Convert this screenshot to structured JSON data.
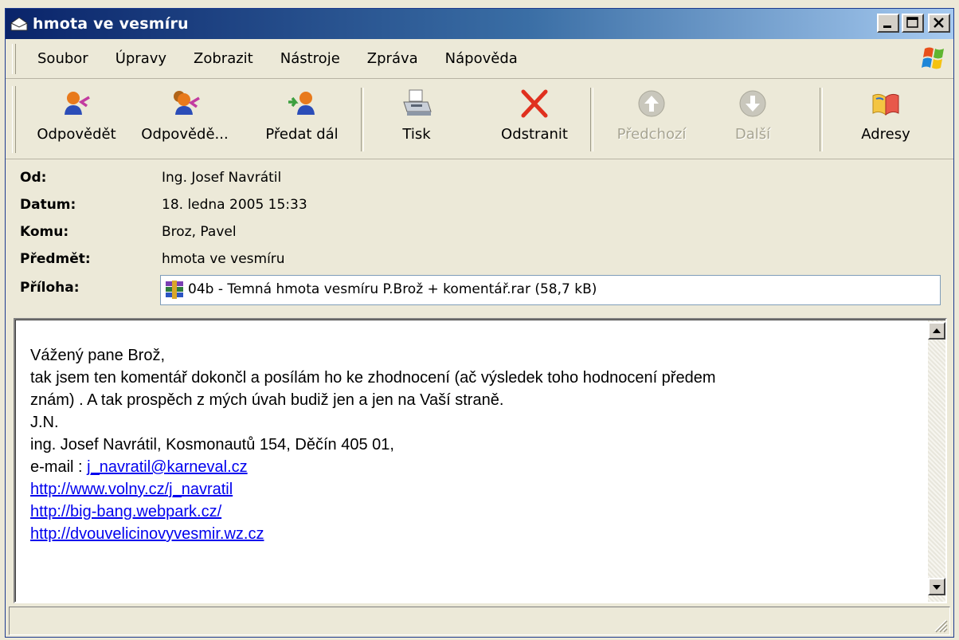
{
  "window": {
    "title": "hmota ve vesmíru",
    "title_icon": "envelope-icon",
    "buttons": [
      "minimize",
      "maximize",
      "close"
    ]
  },
  "menu": {
    "items": [
      "Soubor",
      "Úpravy",
      "Zobrazit",
      "Nástroje",
      "Zpráva",
      "Nápověda"
    ]
  },
  "toolbar": {
    "buttons": [
      {
        "label": "Odpovědět",
        "icon": "reply-icon",
        "enabled": true
      },
      {
        "label": "Odpovědě...",
        "icon": "reply-all-icon",
        "enabled": true
      },
      {
        "label": "Předat dál",
        "icon": "forward-icon",
        "enabled": true
      },
      {
        "label": "Tisk",
        "icon": "printer-icon",
        "enabled": true
      },
      {
        "label": "Odstranit",
        "icon": "delete-icon",
        "enabled": true
      },
      {
        "label": "Předchozí",
        "icon": "up-arrow-icon",
        "enabled": false
      },
      {
        "label": "Další",
        "icon": "down-arrow-icon",
        "enabled": false
      },
      {
        "label": "Adresy",
        "icon": "address-book-icon",
        "enabled": true
      }
    ]
  },
  "headers": {
    "from_label": "Od:",
    "from": "Ing. Josef Navrátil",
    "date_label": "Datum:",
    "date": "18. ledna 2005 15:33",
    "to_label": "Komu:",
    "to": "Broz, Pavel",
    "subject_label": "Předmět:",
    "subject": "hmota ve vesmíru",
    "attachment_label": "Příloha:",
    "attachment": "04b - Temná hmota vesmíru P.Brož + komentář.rar (58,7 kB)"
  },
  "body": {
    "greeting": "Vážený pane Brož,",
    "line1": "tak jsem ten komentář dokončl a posílám ho ke zhodnocení (ač výsledek toho hodnocení předem",
    "line2": "znám) . A tak prospěch z mých úvah budiž jen a jen na Vaší straně.",
    "initials": "J.N.",
    "address": "ing. Josef Navrátil, Kosmonautů 154, Děčín  405 01,",
    "email_prefix": "e-mail : ",
    "email": "j_navratil@karneval.cz",
    "link1": "http://www.volny.cz/j_navratil",
    "link2": "http://big-bang.webpark.cz/",
    "link3": "http://dvouvelicinovyvesmir.wz.cz"
  },
  "colors": {
    "titlebar_start": "#0a246a",
    "titlebar_end": "#a6caf0",
    "link": "#0000ee",
    "window_bg": "#ece9d8"
  }
}
